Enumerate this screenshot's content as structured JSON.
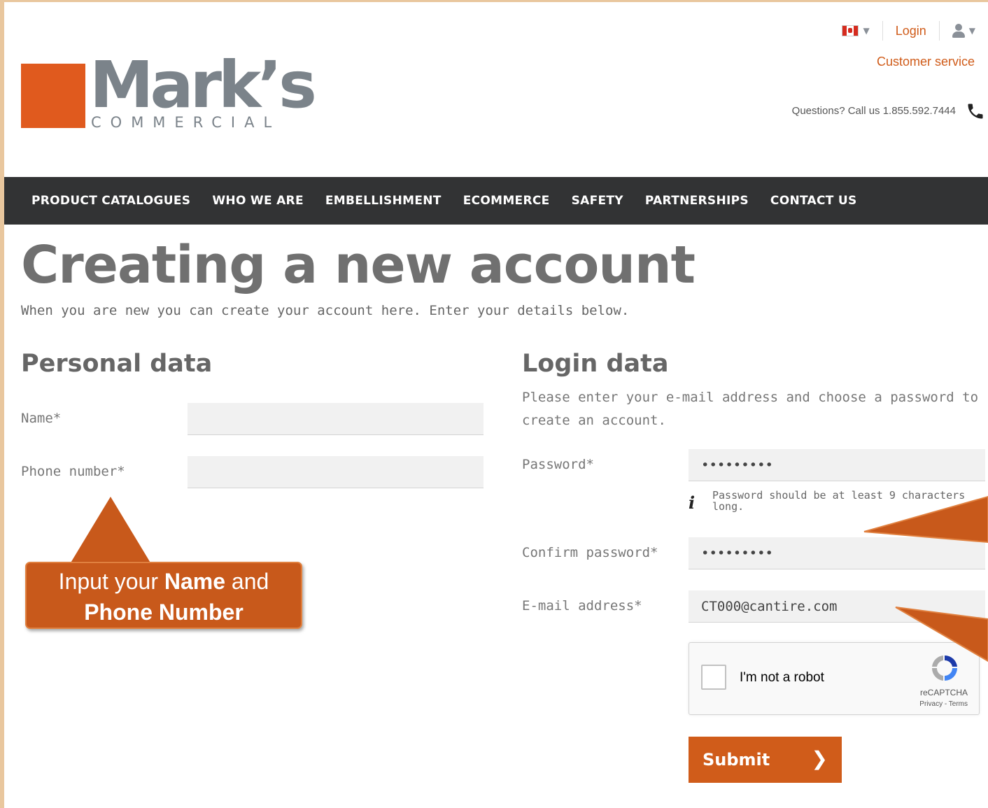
{
  "brand": {
    "name": "Mark’s",
    "sub": "COMMERCIAL",
    "color": "#e05a1e"
  },
  "topbar": {
    "login": "Login",
    "customer_service": "Customer service",
    "questions": "Questions? Call us 1.855.592.7444"
  },
  "nav": {
    "items": [
      "PRODUCT CATALOGUES",
      "WHO WE ARE",
      "EMBELLISHMENT",
      "ECOMMERCE",
      "SAFETY",
      "PARTNERSHIPS",
      "CONTACT US"
    ]
  },
  "page": {
    "title": "Creating a new account",
    "intro": "When you are new you can create your account here. Enter your details below."
  },
  "personal": {
    "heading": "Personal data",
    "name_label": "Name*",
    "name_value": "",
    "phone_label": "Phone number*",
    "phone_value": ""
  },
  "login": {
    "heading": "Login data",
    "description": "Please enter your e-mail address and choose a password to create an account.",
    "password_label": "Password*",
    "password_value": "•••••••••",
    "password_hint": "Password should be at least 9 characters long.",
    "confirm_label": "Confirm password*",
    "confirm_value": "•••••••••",
    "email_label": "E-mail address*",
    "email_value": "CT000@cantire.com",
    "submit": "Submit"
  },
  "recaptcha": {
    "label": "I'm not a robot",
    "brand": "reCAPTCHA",
    "links": "Privacy - Terms"
  },
  "callout": {
    "prefix": "Input your ",
    "bold1": "Name",
    "middle": " and",
    "bold2": "Phone Number",
    "color": "#c8591b"
  }
}
